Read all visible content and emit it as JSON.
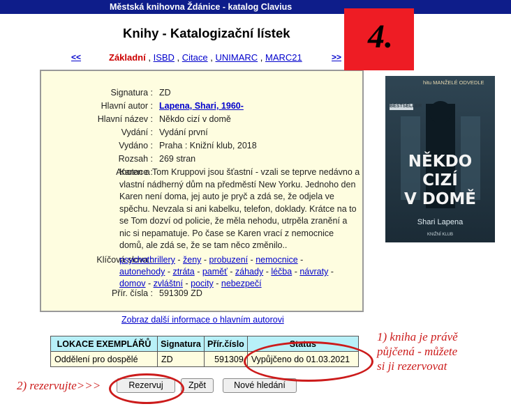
{
  "topbar": {
    "title": "Městská knihovna Ždánice - katalog Clavius"
  },
  "page_title": "Knihy - Katalogizační lístek",
  "nav": {
    "prev": "<<",
    "next": ">>",
    "current": "Základní",
    "links": [
      "ISBD",
      "Citace",
      "UNIMARC",
      "MARC21"
    ]
  },
  "step_badge": "4.",
  "record": {
    "signatura": {
      "label": "Signatura :",
      "value": "ZD"
    },
    "autor": {
      "label": "Hlavní autor :",
      "value": "Lapena, Shari, 1960-"
    },
    "nazev": {
      "label": "Hlavní název :",
      "value": "Někdo cizí v domě"
    },
    "vydani": {
      "label": "Vydání :",
      "value": "Vydání první"
    },
    "vydano": {
      "label": "Vydáno :",
      "value": "Praha : Knižní klub, 2018"
    },
    "rozsah": {
      "label": "Rozsah :",
      "value": "269 stran"
    },
    "anotace": {
      "label": "Anotace :",
      "value": "Karen a Tom Kruppovi jsou šťastní - vzali se teprve nedávno a vlastní nádherný dům na předměstí New Yorku. Jednoho den Karen není doma, jej auto je pryč a zdá se, že odjela ve spěchu. Nevzala si ani kabelku, telefon, doklady. Krátce na to se Tom dozví od policie, že měla nehodu, utrpěla zranění a nic si nepamatuje. Po čase se Karen vrací z nemocnice domů, ale zdá se, že se tam něco změnilo.."
    },
    "klicova": {
      "label": "Klíčová slova :",
      "items": [
        "psychothrillery",
        "ženy",
        "probuzení",
        "nemocnice",
        "autonehody",
        "ztráta",
        "paměť",
        "záhady",
        "léčba",
        "návraty",
        "domov",
        "zvláštní",
        "pocity",
        "nebezpečí"
      ]
    },
    "cisla": {
      "label": "Přír. čísla :",
      "value": "591309 ZD"
    }
  },
  "cover": {
    "top_text": "hitu MANŽELÉ ODVEDLE",
    "badge": "BESTSELLER",
    "title_lines": [
      "NĚKDO",
      "CIZÍ",
      "V DOMĚ"
    ],
    "author": "Shari Lapena",
    "publisher": "KNIŽNÍ KLUB"
  },
  "more_link": "Zobraz další informace o hlavním autorovi",
  "locations": {
    "headers": [
      "LOKACE EXEMPLÁŘŮ",
      "Signatura",
      "Přír.číslo",
      "Status"
    ],
    "rows": [
      [
        "Oddělení pro dospělé",
        "ZD",
        "591309",
        "Vypůjčeno do 01.03.2021"
      ]
    ]
  },
  "buttons": {
    "reserve": "Rezervuj",
    "back": "Zpět",
    "new_search": "Nové hledání"
  },
  "annotations": {
    "note1": [
      "1) kniha je právě",
      "půjčená - můžete",
      "si ji rezervovat"
    ],
    "note2": "2) rezervujte>>>"
  },
  "colors": {
    "topbar": "#0e1d8a",
    "card": "#fefde0",
    "table_header": "#b8f0f8",
    "annotation": "#cc1b1b",
    "badge": "#ee1c24"
  }
}
